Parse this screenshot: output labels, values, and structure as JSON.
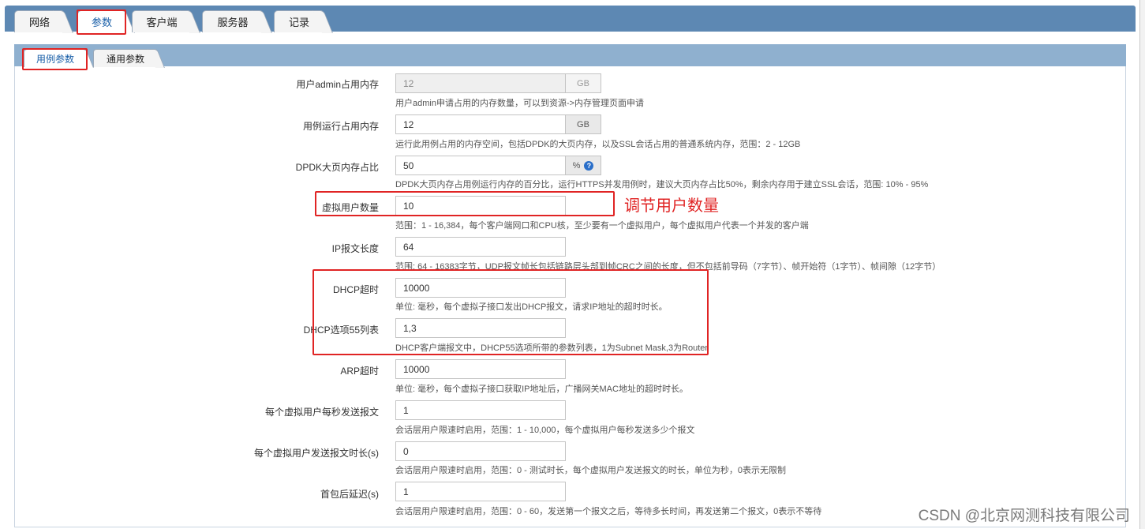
{
  "top_tabs": [
    {
      "label": "网络"
    },
    {
      "label": "参数"
    },
    {
      "label": "客户端"
    },
    {
      "label": "服务器"
    },
    {
      "label": "记录"
    }
  ],
  "sub_tabs": [
    {
      "label": "用例参数"
    },
    {
      "label": "通用参数"
    }
  ],
  "fields": {
    "admin_memory": {
      "label": "用户admin占用内存",
      "value": "12",
      "unit": "GB",
      "hint": "用户admin申请占用的内存数量，可以到资源->内存管理页面申请"
    },
    "run_memory": {
      "label": "用例运行占用内存",
      "value": "12",
      "unit": "GB",
      "hint": "运行此用例占用的内存空间，包括DPDK的大页内存，以及SSL会话占用的普通系统内存，范围：2 - 12GB"
    },
    "dpdk_ratio": {
      "label": "DPDK大页内存占比",
      "value": "50",
      "unit": "%",
      "help": "?",
      "hint": "DPDK大页内存占用例运行内存的百分比，运行HTTPS并发用例时，建议大页内存占比50%，剩余内存用于建立SSL会话，范围: 10% - 95%"
    },
    "virtual_users": {
      "label": "虚拟用户数量",
      "value": "10",
      "hint": "范围：1 - 16,384，每个客户端网口和CPU核，至少要有一个虚拟用户，每个虚拟用户代表一个并发的客户端"
    },
    "ip_length": {
      "label": "IP报文长度",
      "value": "64",
      "hint": "范围: 64 - 16383字节，UDP报文帧长包括链路层头部到帧CRC之间的长度，但不包括前导码（7字节）、帧开始符（1字节）、帧间隙（12字节）"
    },
    "dhcp_timeout": {
      "label": "DHCP超时",
      "value": "10000",
      "hint": "单位: 毫秒，每个虚拟子接口发出DHCP报文，请求IP地址的超时时长。"
    },
    "dhcp_option55": {
      "label": "DHCP选项55列表",
      "value": "1,3",
      "hint": "DHCP客户端报文中，DHCP55选项所带的参数列表，1为Subnet Mask,3为Router"
    },
    "arp_timeout": {
      "label": "ARP超时",
      "value": "10000",
      "hint": "单位: 毫秒，每个虚拟子接口获取IP地址后，广播网关MAC地址的超时时长。"
    },
    "send_per_sec": {
      "label": "每个虚拟用户每秒发送报文",
      "value": "1",
      "hint": "会话层用户限速时启用，范围：1 - 10,000，每个虚拟用户每秒发送多少个报文"
    },
    "send_duration": {
      "label": "每个虚拟用户发送报文时长(s)",
      "value": "0",
      "hint": "会话层用户限速时启用，范围：0 - 测试时长，每个虚拟用户发送报文的时长，单位为秒，0表示无限制"
    },
    "first_delay": {
      "label": "首包后延迟(s)",
      "value": "1",
      "hint": "会话层用户限速时启用，范围：0 - 60，发送第一个报文之后，等待多长时间，再发送第二个报文，0表示不等待"
    }
  },
  "annotation": "调节用户数量",
  "watermark": "CSDN @北京网测科技有限公司",
  "colors": {
    "tab_strip": "#5d88b3",
    "sub_strip": "#8fb0cf",
    "highlight": "#e02424",
    "active_tab_text": "#1a5fa8"
  }
}
